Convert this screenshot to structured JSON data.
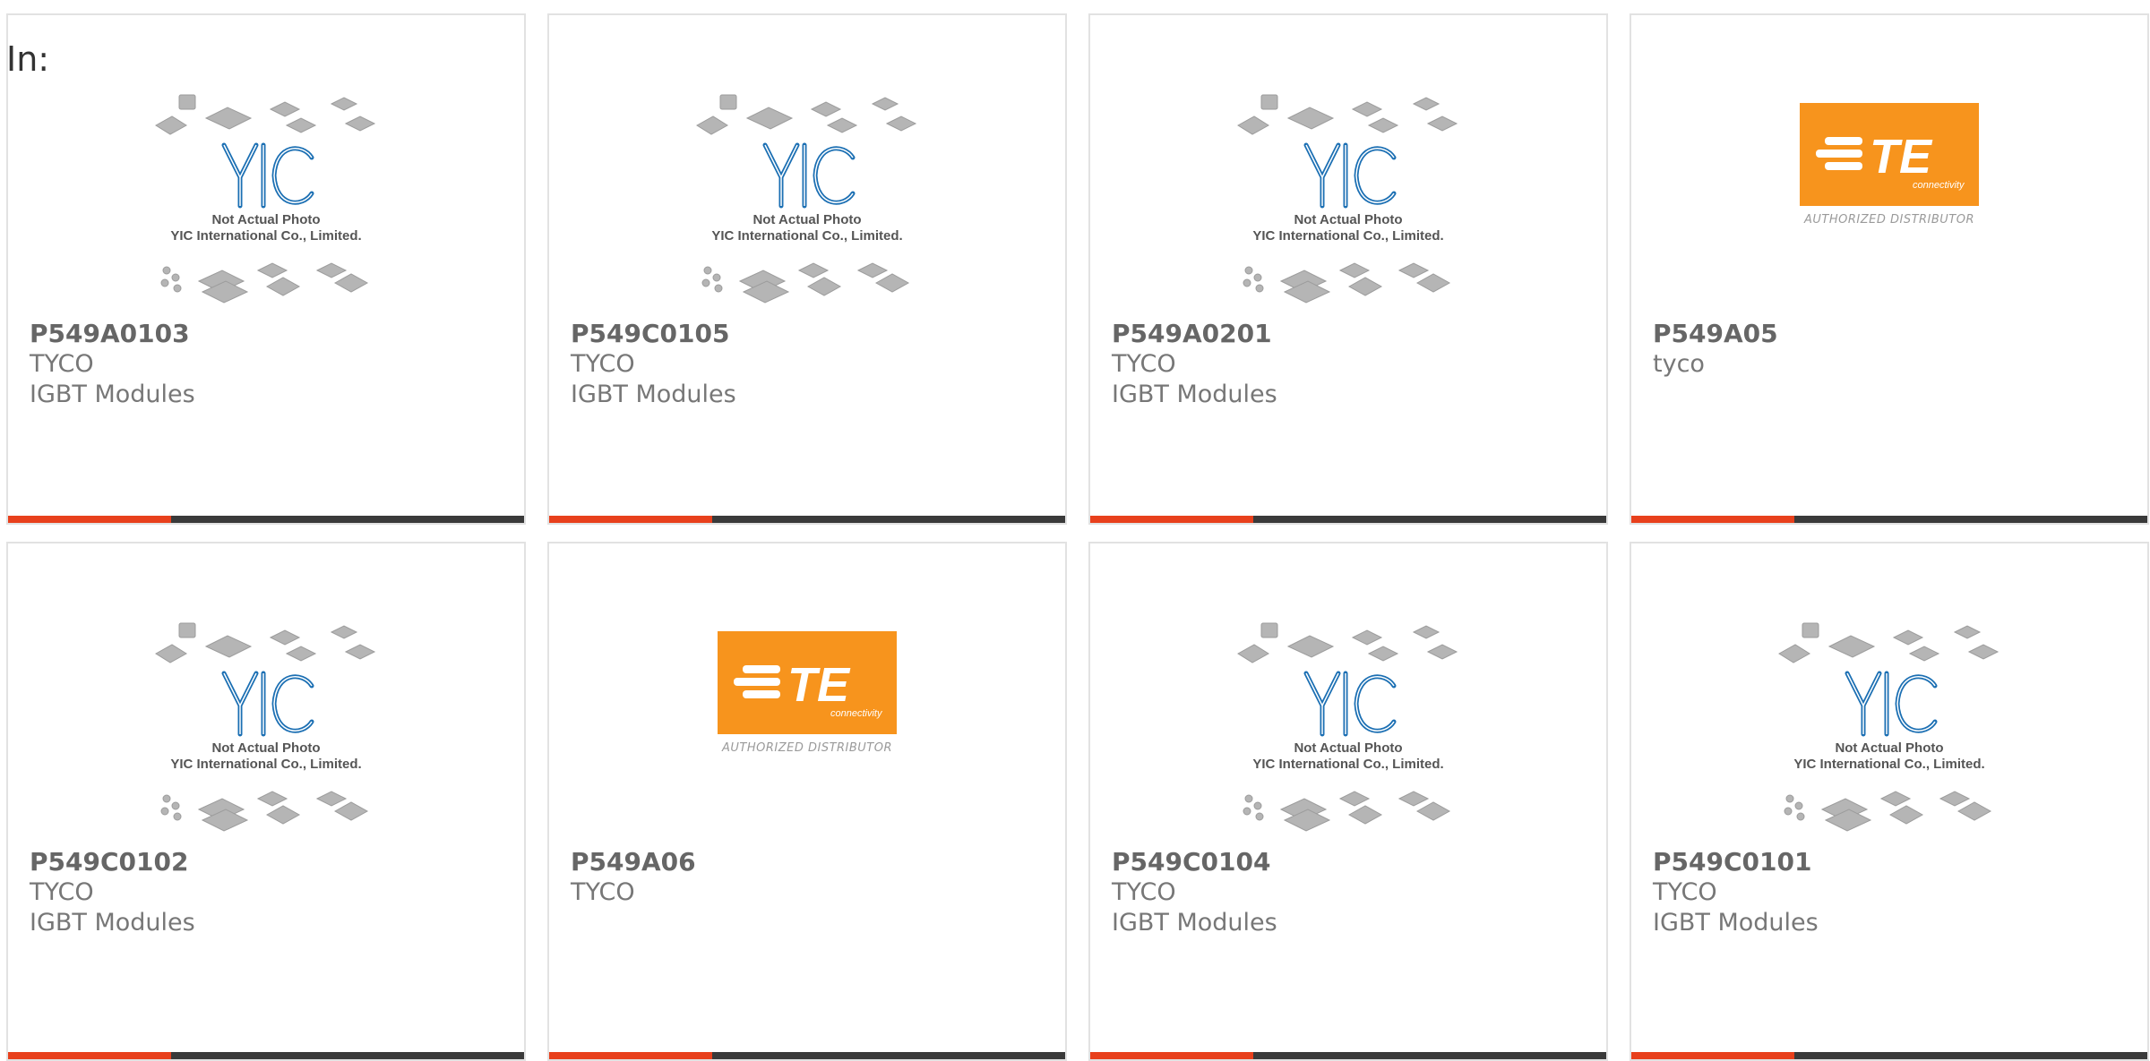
{
  "header": {
    "in_label": "In:"
  },
  "placeholder": {
    "line1": "Not Actual Photo",
    "line2": "YIC International Co., Limited."
  },
  "te_logo": {
    "word": "TE",
    "sub": "connectivity",
    "caption": "AUTHORIZED DISTRIBUTOR"
  },
  "colors": {
    "accent": "#e8401c",
    "bar": "#3a3a3a",
    "te_orange": "#f7941d",
    "yic_blue": "#1b6fb3"
  },
  "products": [
    {
      "part": "P549A0103",
      "maker": "TYCO",
      "category": "IGBT Modules",
      "image": "yic-placeholder"
    },
    {
      "part": "P549C0105",
      "maker": "TYCO",
      "category": "IGBT Modules",
      "image": "yic-placeholder"
    },
    {
      "part": "P549A0201",
      "maker": "TYCO",
      "category": "IGBT Modules",
      "image": "yic-placeholder"
    },
    {
      "part": "P549A05",
      "maker": "tyco",
      "category": "",
      "image": "te-logo"
    },
    {
      "part": "P549C0102",
      "maker": "TYCO",
      "category": "IGBT Modules",
      "image": "yic-placeholder"
    },
    {
      "part": "P549A06",
      "maker": "TYCO",
      "category": "",
      "image": "te-logo"
    },
    {
      "part": "P549C0104",
      "maker": "TYCO",
      "category": "IGBT Modules",
      "image": "yic-placeholder"
    },
    {
      "part": "P549C0101",
      "maker": "TYCO",
      "category": "IGBT Modules",
      "image": "yic-placeholder"
    }
  ]
}
